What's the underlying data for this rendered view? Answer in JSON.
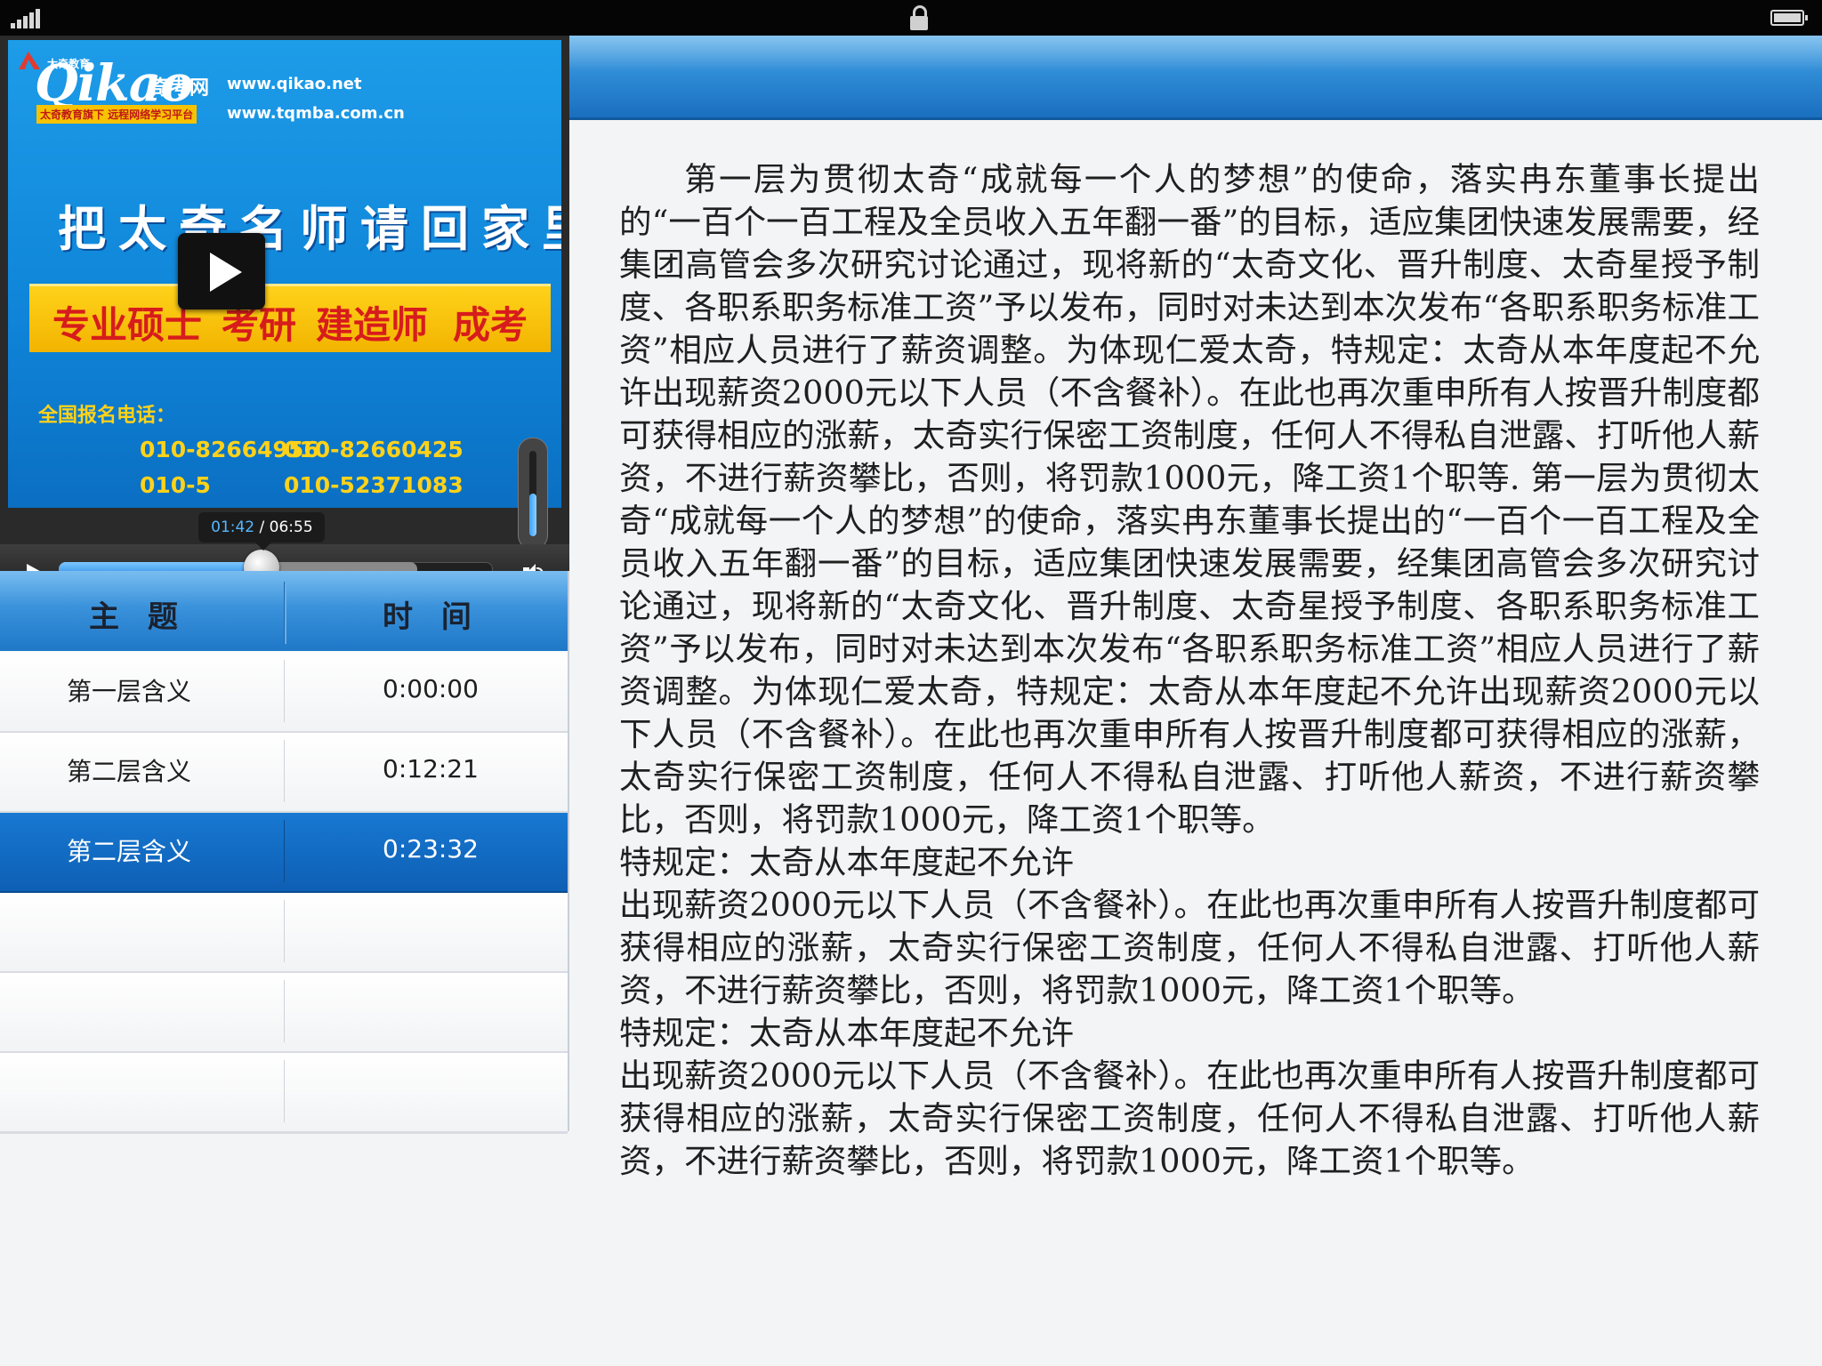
{
  "video": {
    "brand": "Qikao",
    "brand_cn": "奇考网",
    "logo_small": "太奇教育",
    "url1": "www.qikao.net",
    "url2": "www.tqmba.com.cn",
    "tagline": "太奇教育旗下 远程网络学习平台",
    "slogan": "把太奇名师请回家里",
    "banner_items": [
      "专业硕士",
      "考研",
      "建造师",
      "成考"
    ],
    "phone_label": "全国报名电话：",
    "phones": [
      "010-82664956",
      "010-82660425",
      "010-5",
      "010-52371083"
    ],
    "current_time": "01:42",
    "separator": " / ",
    "duration": "06:55",
    "progress_played": 0.47,
    "progress_buffered": 0.83,
    "volume_level": 0.5
  },
  "table": {
    "header_topic": "主 题",
    "header_time": "时 间",
    "rows": [
      {
        "topic": "第一层含义",
        "time": "0:00:00",
        "selected": false
      },
      {
        "topic": "第二层含义",
        "time": "0:12:21",
        "selected": false
      },
      {
        "topic": "第二层含义",
        "time": "0:23:32",
        "selected": true
      },
      {
        "topic": "",
        "time": "",
        "selected": false
      },
      {
        "topic": "",
        "time": "",
        "selected": false
      },
      {
        "topic": "",
        "time": "",
        "selected": false
      }
    ]
  },
  "content": {
    "paragraphs": [
      "第一层为贯彻太奇“成就每一个人的梦想”的使命，落实冉东董事长提出的“一百个一百工程及全员收入五年翻一番”的目标，适应集团快速发展需要，经集团高管会多次研究讨论通过，现将新的“太奇文化、晋升制度、太奇星授予制度、各职系职务标准工资”予以发布，同时对未达到本次发布“各职系职务标准工资”相应人员进行了薪资调整。为体现仁爱太奇，特规定：太奇从本年度起不允许出现薪资2000元以下人员（不含餐补）。在此也再次重申所有人按晋升制度都可获得相应的涨薪，太奇实行保密工资制度，任何人不得私自泄露、打听他人薪资，不进行薪资攀比，否则，将罚款1000元，降工资1个职等. 第一层为贯彻太奇“成就每一个人的梦想”的使命，落实冉东董事长提出的“一百个一百工程及全员收入五年翻一番”的目标，适应集团快速发展需要，经集团高管会多次研究讨论通过，现将新的“太奇文化、晋升制度、太奇星授予制度、各职系职务标准工资”予以发布，同时对未达到本次发布“各职系职务标准工资”相应人员进行了薪资调整。为体现仁爱太奇，特规定：太奇从本年度起不允许出现薪资2000元以下人员（不含餐补）。在此也再次重申所有人按晋升制度都可获得相应的涨薪，太奇实行保密工资制度，任何人不得私自泄露、打听他人薪资，不进行薪资攀比，否则，将罚款1000元，降工资1个职等。",
      "特规定：太奇从本年度起不允许",
      "出现薪资2000元以下人员（不含餐补）。在此也再次重申所有人按晋升制度都可获得相应的涨薪，太奇实行保密工资制度，任何人不得私自泄露、打听他人薪资，不进行薪资攀比，否则，将罚款1000元，降工资1个职等。",
      "特规定：太奇从本年度起不允许",
      "出现薪资2000元以下人员（不含餐补）。在此也再次重申所有人按晋升制度都可获得相应的涨薪，太奇实行保密工资制度，任何人不得私自泄露、打听他人薪资，不进行薪资攀比，否则，将罚款1000元，降工资1个职等。"
    ]
  }
}
